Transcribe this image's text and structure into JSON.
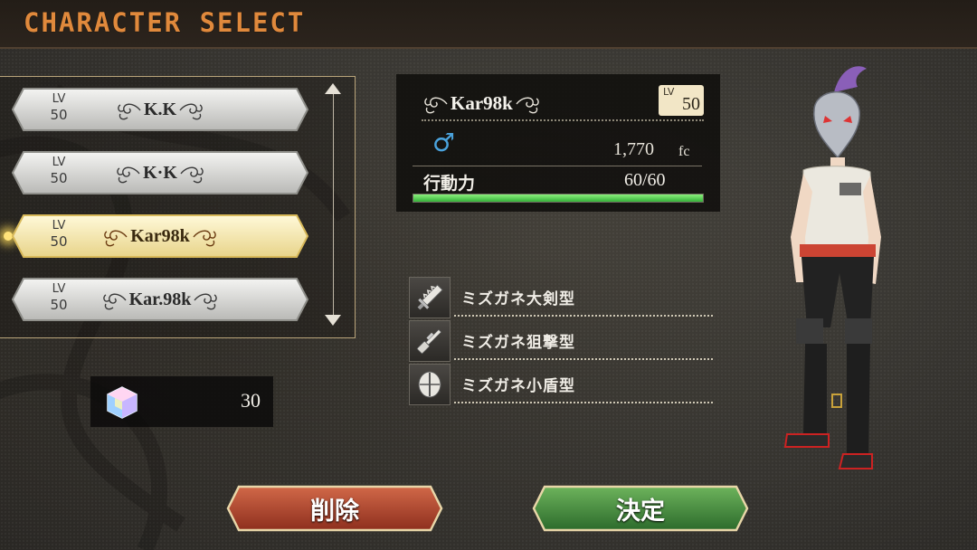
{
  "screen": {
    "title": "CHARACTER SELECT"
  },
  "character_list": [
    {
      "lv_label": "LV",
      "level": "50",
      "name": "K.K",
      "selected": false
    },
    {
      "lv_label": "LV",
      "level": "50",
      "name": "K·K",
      "selected": false
    },
    {
      "lv_label": "LV",
      "level": "50",
      "name": "Kar98k",
      "selected": true
    },
    {
      "lv_label": "LV",
      "level": "50",
      "name": "Kar.98k",
      "selected": false
    }
  ],
  "currency": {
    "icon": "prism-cube-icon",
    "amount": "30"
  },
  "info": {
    "name": "Kar98k",
    "lv_label": "LV",
    "level": "50",
    "gender_symbol": "♂",
    "money": "1,770",
    "money_unit": "fc",
    "action_label": "行動力",
    "action_value": "60/60",
    "action_fraction": 1.0
  },
  "weapons": [
    {
      "label": "ミズガネ大剣型",
      "icon": "greatsword-icon"
    },
    {
      "label": "ミズガネ狙撃型",
      "icon": "sniper-rifle-icon"
    },
    {
      "label": "ミズガネ小盾型",
      "icon": "small-shield-icon"
    }
  ],
  "buttons": {
    "delete": "削除",
    "confirm": "決定"
  },
  "colors": {
    "title": "#e0893c",
    "selected_plate": "#f7eab2",
    "delete_button": "#b2442c",
    "confirm_button": "#3f8a3e",
    "action_bar": "#35b13a",
    "gender": "#4aa3dd"
  }
}
